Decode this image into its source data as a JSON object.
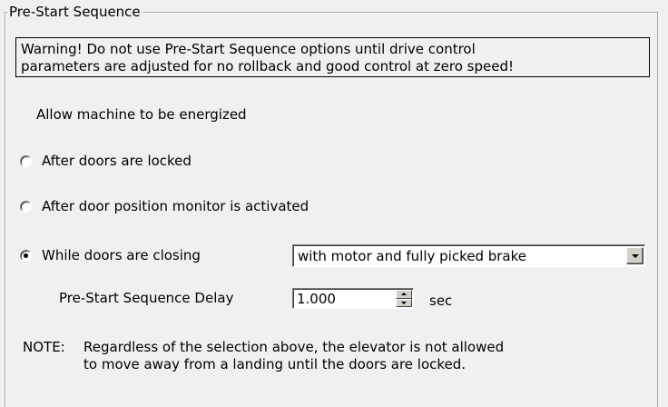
{
  "group": {
    "title": "Pre-Start Sequence"
  },
  "warning": {
    "line1": "Warning! Do not use Pre-Start Sequence options until drive control",
    "line2": "parameters are adjusted for no rollback and good control at zero speed!"
  },
  "allow_label": "Allow machine to be energized",
  "options": [
    {
      "label": "After doors are locked",
      "checked": false
    },
    {
      "label": "After door position monitor is activated",
      "checked": false
    },
    {
      "label": "While doors are closing",
      "checked": true
    }
  ],
  "closing_mode": {
    "selected": "with motor and fully picked brake"
  },
  "delay": {
    "label": "Pre-Start Sequence Delay",
    "value": "1.000",
    "unit": "sec"
  },
  "note": {
    "label": "NOTE:",
    "line1": "Regardless of the selection above, the elevator is not allowed",
    "line2": "to move away from a landing until the doors are locked."
  }
}
